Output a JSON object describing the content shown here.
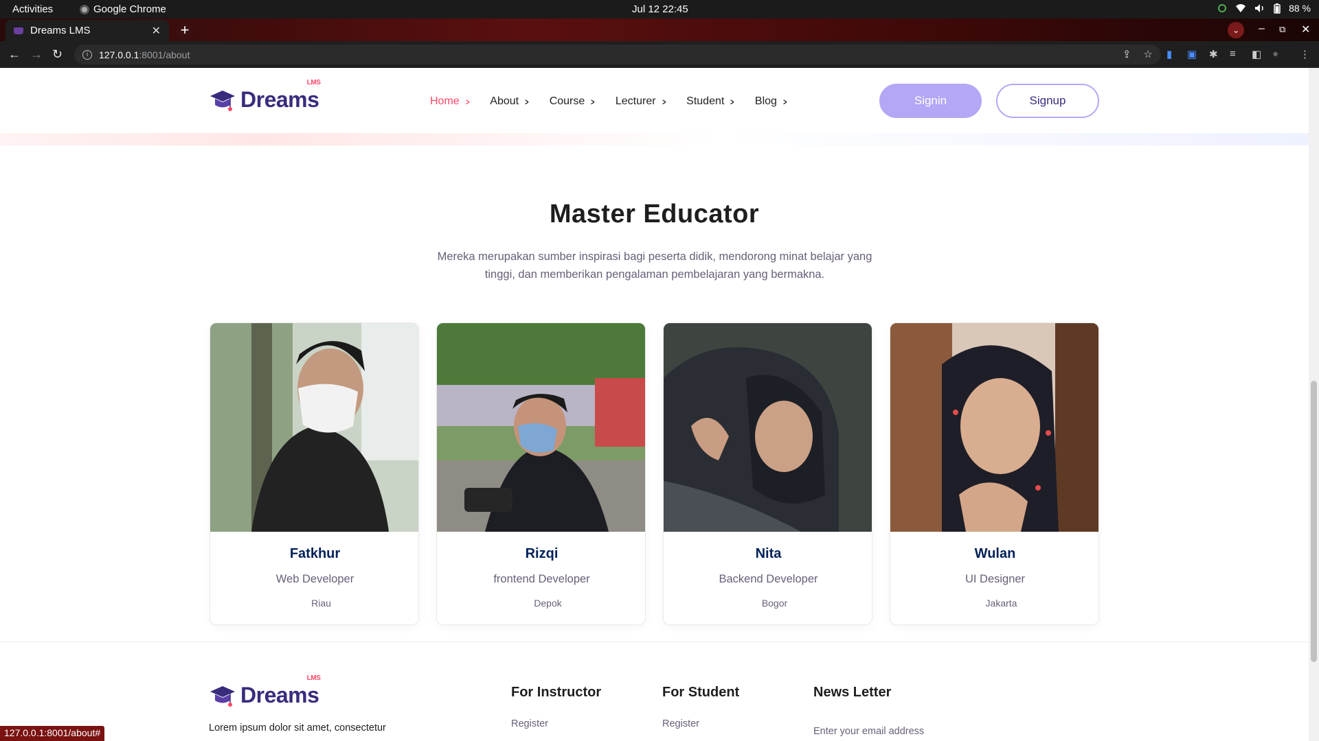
{
  "system": {
    "activities": "Activities",
    "app_name": "Google Chrome",
    "clock": "Jul 12  22:45",
    "battery": "88 %"
  },
  "browser": {
    "tab_title": "Dreams LMS",
    "url_host": "127.0.0.1",
    "url_path": ":8001/about",
    "status_url": "127.0.0.1:8001/about#"
  },
  "header": {
    "logo_word": "Dreams",
    "logo_badge": "LMS",
    "nav": [
      {
        "label": "Home"
      },
      {
        "label": "About"
      },
      {
        "label": "Course"
      },
      {
        "label": "Lecturer"
      },
      {
        "label": "Student"
      },
      {
        "label": "Blog"
      }
    ],
    "signin": "Signin",
    "signup": "Signup"
  },
  "section": {
    "title": "Master Educator",
    "subtitle_line1": "Mereka merupakan sumber inspirasi bagi peserta didik, mendorong minat belajar yang",
    "subtitle_line2": "tinggi, dan memberikan pengalaman pembelajaran yang bermakna."
  },
  "educators": [
    {
      "name": "Fatkhur",
      "role": "Web Developer",
      "location": "Riau"
    },
    {
      "name": "Rizqi",
      "role": "frontend Developer",
      "location": "Depok"
    },
    {
      "name": "Nita",
      "role": "Backend Developer",
      "location": "Bogor"
    },
    {
      "name": "Wulan",
      "role": "UI Designer",
      "location": "Jakarta"
    }
  ],
  "footer": {
    "text": "Lorem ipsum dolor sit amet, consectetur",
    "col_instructor": "For Instructor",
    "col_student": "For Student",
    "col_newsletter": "News Letter",
    "instructor_link": "Register",
    "student_link": "Register",
    "email_placeholder": "Enter your email address"
  },
  "colors": {
    "brand": "#392c7d",
    "accent": "#ff4667",
    "button": "#b4a7f5"
  }
}
